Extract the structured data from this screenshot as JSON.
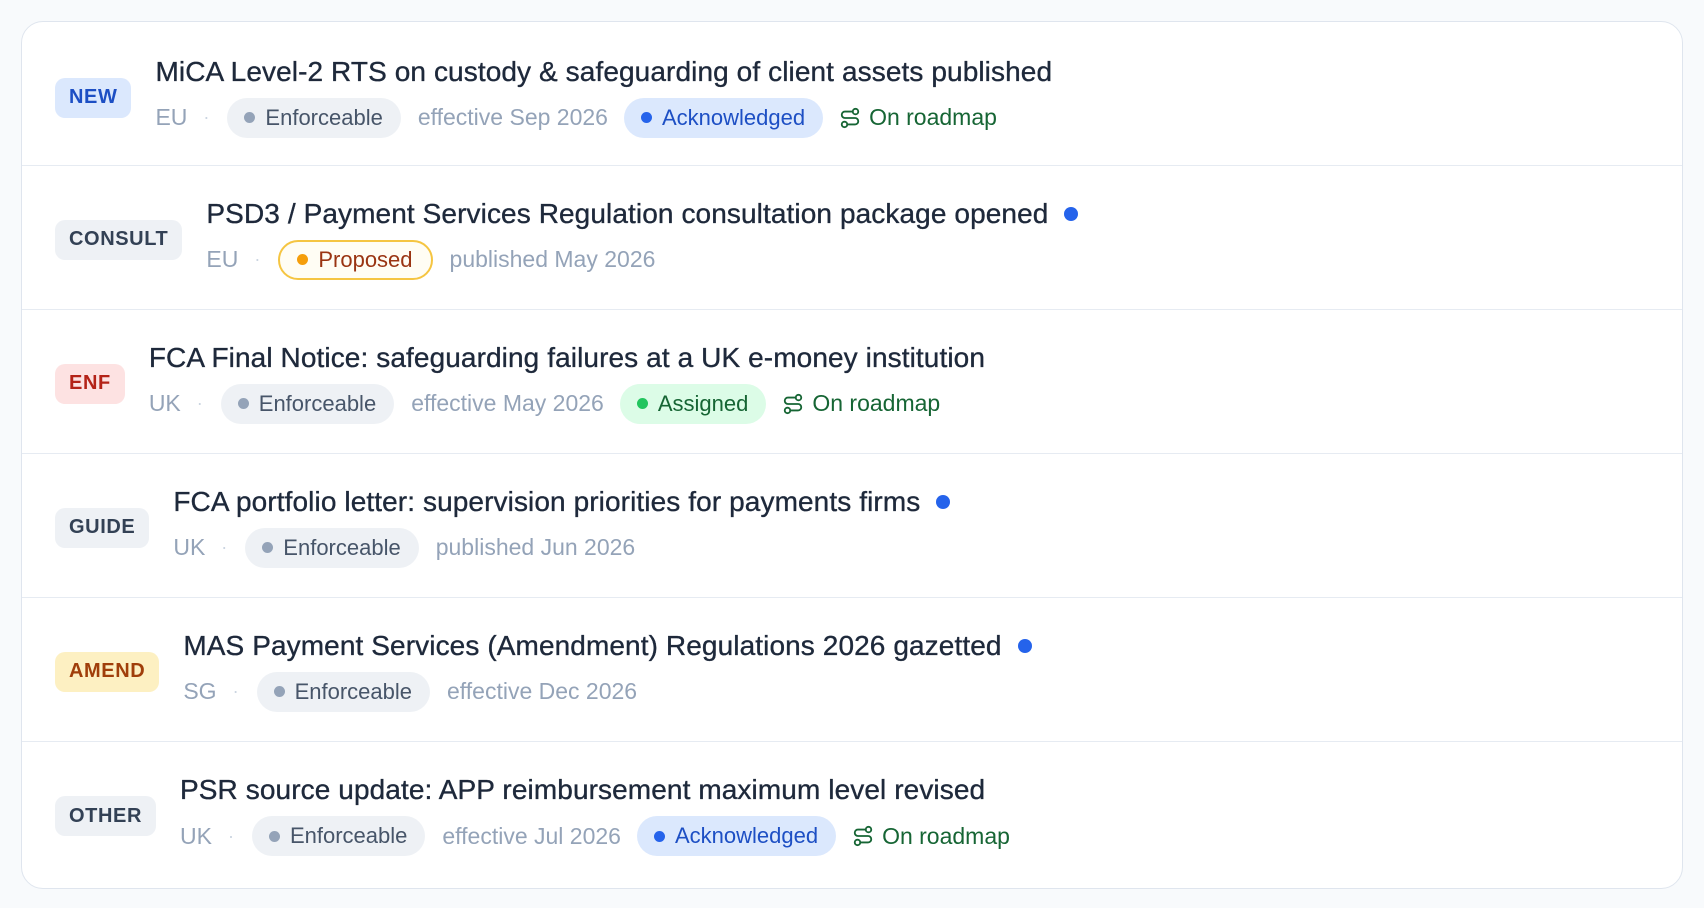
{
  "items": [
    {
      "tag": "NEW",
      "title": "MiCA Level-2 RTS on custody & safeguarding of client assets published",
      "region": "EU",
      "separator": "·",
      "status": "Enforceable",
      "date": "effective Sep 2026",
      "workflow": "Acknowledged",
      "roadmap": "On roadmap"
    },
    {
      "tag": "CONSULT",
      "title": "PSD3 / Payment Services Regulation consultation package opened",
      "region": "EU",
      "separator": "·",
      "status": "Proposed",
      "date": "published May 2026"
    },
    {
      "tag": "ENF",
      "title": "FCA Final Notice: safeguarding failures at a UK e-money institution",
      "region": "UK",
      "separator": "·",
      "status": "Enforceable",
      "date": "effective May 2026",
      "workflow": "Assigned",
      "roadmap": "On roadmap"
    },
    {
      "tag": "GUIDE",
      "title": "FCA portfolio letter: supervision priorities for payments firms",
      "region": "UK",
      "separator": "·",
      "status": "Enforceable",
      "date": "published Jun 2026"
    },
    {
      "tag": "AMEND",
      "title": "MAS Payment Services (Amendment) Regulations 2026 gazetted",
      "region": "SG",
      "separator": "·",
      "status": "Enforceable",
      "date": "effective Dec 2026"
    },
    {
      "tag": "OTHER",
      "title": "PSR source update: APP reimbursement maximum level revised",
      "region": "UK",
      "separator": "·",
      "status": "Enforceable",
      "date": "effective Jul 2026",
      "workflow": "Acknowledged",
      "roadmap": "On roadmap"
    }
  ]
}
